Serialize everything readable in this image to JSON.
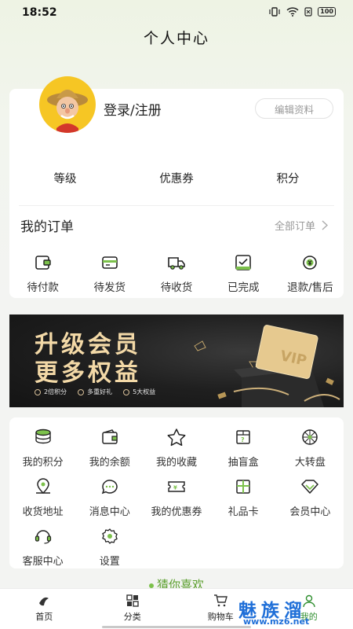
{
  "status_bar": {
    "time": "18:52",
    "battery": "100"
  },
  "page_title": "个人中心",
  "profile": {
    "login_label": "登录/注册",
    "edit_label": "编辑资料",
    "stats": [
      {
        "label": "等级"
      },
      {
        "label": "优惠券"
      },
      {
        "label": "积分"
      }
    ]
  },
  "orders": {
    "title": "我的订单",
    "all_label": "全部订单",
    "items": [
      {
        "label": "待付款",
        "icon": "wallet-icon"
      },
      {
        "label": "待发货",
        "icon": "card-icon"
      },
      {
        "label": "待收货",
        "icon": "truck-icon"
      },
      {
        "label": "已完成",
        "icon": "check-box-icon"
      },
      {
        "label": "退款/售后",
        "icon": "refund-icon"
      }
    ]
  },
  "banner": {
    "line1": "升级会员",
    "line2": "更多权益",
    "tags": [
      "2倍积分",
      "多重好礼",
      "5大权益"
    ],
    "card_text": "VIP"
  },
  "services": [
    {
      "label": "我的积分",
      "icon": "coins-icon"
    },
    {
      "label": "我的余额",
      "icon": "balance-wallet-icon"
    },
    {
      "label": "我的收藏",
      "icon": "star-icon"
    },
    {
      "label": "抽盲盒",
      "icon": "blind-box-icon"
    },
    {
      "label": "大转盘",
      "icon": "wheel-icon"
    },
    {
      "label": "收货地址",
      "icon": "location-icon"
    },
    {
      "label": "消息中心",
      "icon": "message-icon"
    },
    {
      "label": "我的优惠券",
      "icon": "coupon-icon"
    },
    {
      "label": "礼品卡",
      "icon": "gift-card-icon"
    },
    {
      "label": "会员中心",
      "icon": "diamond-icon"
    },
    {
      "label": "客服中心",
      "icon": "headset-icon"
    },
    {
      "label": "设置",
      "icon": "settings-icon"
    }
  ],
  "guess_title": "猜你喜欢",
  "tabs": [
    {
      "label": "首页",
      "icon": "home-icon"
    },
    {
      "label": "分类",
      "icon": "category-icon"
    },
    {
      "label": "购物车",
      "icon": "cart-icon"
    },
    {
      "label": "我的",
      "icon": "profile-icon"
    }
  ],
  "watermark": {
    "big": "魅族溜",
    "small": "www.mz6.net"
  },
  "colors": {
    "accent": "#2f8f2f",
    "guess": "#5a9e2c",
    "banner_gold": "#f3d9a7",
    "watermark": "#1f6fd8"
  }
}
